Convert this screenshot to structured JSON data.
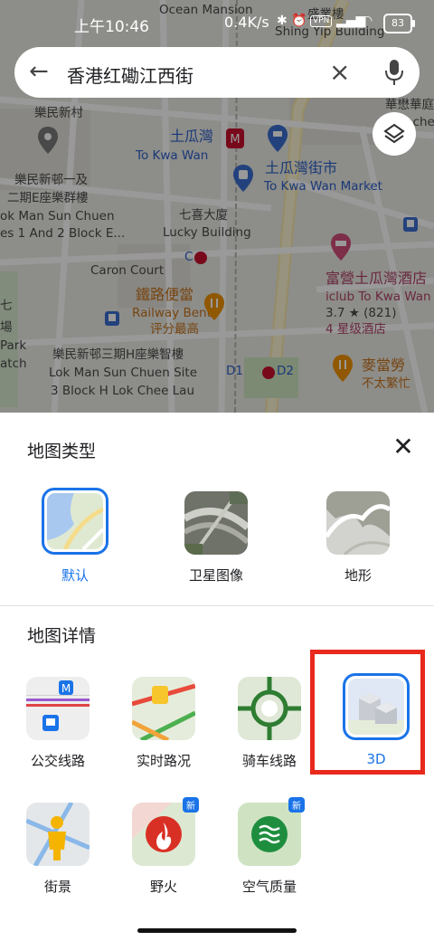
{
  "status_bar": {
    "time": "上午10:46",
    "speed": "0.4K/s",
    "battery": "83",
    "vpn_label": "VPN",
    "icons": [
      "bluetooth-icon",
      "alarm-icon",
      "vpn-icon",
      "signal-icon",
      "wifi-icon",
      "battery-icon"
    ]
  },
  "search": {
    "query": "香港红磡江西街",
    "back_icon": "arrow-back-icon",
    "clear_icon": "close-icon",
    "mic_icon": "mic-icon"
  },
  "map": {
    "labels": {
      "l1": "Ocean Mansion",
      "l2": "盛業樓",
      "l3": "Shing Yip Building",
      "l4": "華懋華庭",
      "l5": "Chinachem",
      "l6": "樂民新村",
      "l7": "土瓜灣",
      "l8": "To Kwa Wan",
      "l9": "土瓜灣街市",
      "l10": "To Kwa Wan Market",
      "l11": "樂民新邨一及",
      "l12": "二期E座樂群樓",
      "l13": "ok Man Sun Chuen",
      "l14": "es 1 And 2 Block E...",
      "l15": "七喜大廈",
      "l16": "Lucky Building",
      "l17": "C",
      "l18": "Caron Court",
      "l19": "富營土瓜灣酒店",
      "l20": "iclub To Kwa Wan",
      "l21": "3.7 ★ (821)",
      "l22": "4 星级酒店",
      "l23": "鐵路便當",
      "l24": "Railway Bento",
      "l25": "评分最高",
      "l26": "樂民新邨三期H座樂智樓",
      "l27": "Lok Man Sun Chuen Site",
      "l28": "3 Block H Lok Chee Lau",
      "l29": "D1",
      "l30": "D2",
      "l31": "麥當勞",
      "l32": "不太繁忙",
      "l33": "七",
      "l34": "場",
      "l35": "Park",
      "l36": "atch"
    }
  },
  "sheet": {
    "map_type_title": "地图类型",
    "map_details_title": "地图详情",
    "close_icon": "close-icon",
    "map_types": [
      {
        "label": "默认",
        "selected": true
      },
      {
        "label": "卫星图像",
        "selected": false
      },
      {
        "label": "地形",
        "selected": false
      }
    ],
    "details": [
      {
        "label": "公交线路",
        "new": false
      },
      {
        "label": "实时路况",
        "new": false
      },
      {
        "label": "骑车线路",
        "new": false
      },
      {
        "label": "3D",
        "new": false,
        "selected": true
      },
      {
        "label": "街景",
        "new": false
      },
      {
        "label": "野火",
        "new": true
      },
      {
        "label": "空气质量",
        "new": true
      }
    ],
    "new_badge": "新"
  },
  "colors": {
    "accent": "#1a73e8",
    "highlight_box": "#e8291c",
    "metro_red": "#c8102e"
  }
}
